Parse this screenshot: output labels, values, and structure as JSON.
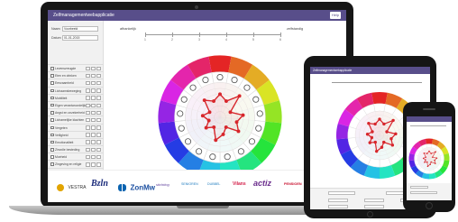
{
  "app": {
    "title": "Zelfmanagementwebapplicatie",
    "help_label": "Help"
  },
  "form": {
    "name_label": "Naam",
    "name_value": "Voorbeeld",
    "date_label": "Datum",
    "date_value": "01-01-2015"
  },
  "themes": [
    "Levensvreugde",
    "Eten en drinken",
    "Eenzaamheid",
    "Lichaamsbeweging",
    "Mobiliteit",
    "Eigen verantwoordelijkheid",
    "Angst en onzekerheid",
    "Lichamelijke klachten",
    "Vergeten",
    "Veiligheid",
    "Emotionaliteit",
    "Zinvolle besteding",
    "Moeheid",
    "Zingeving en religie",
    "Wonen en zorg"
  ],
  "scale": {
    "left_label": "afhankelijk",
    "right_label": "zelfstandig",
    "ticks": [
      "1",
      "2",
      "3",
      "4",
      "5",
      "6"
    ]
  },
  "chart_data": {
    "type": "radar",
    "values": [
      4,
      3,
      5,
      2,
      4,
      3,
      4,
      2,
      3,
      4,
      2,
      3,
      2,
      3,
      2,
      4,
      3
    ],
    "range": [
      0,
      6
    ],
    "line_color": "#d7262b"
  },
  "colors": {
    "accent": "#584e8a",
    "device": "#161616",
    "line": "#d7262b"
  },
  "wheel_icons": [
    "smile-icon",
    "fork-icon",
    "group-icon",
    "walking-icon",
    "car-icon",
    "scales-icon",
    "fear-icon",
    "bandage-icon",
    "memory-icon",
    "lock-icon",
    "heart-icon",
    "hands-icon",
    "bed-icon",
    "church-icon",
    "house-icon",
    "phone-icon",
    "book-icon"
  ],
  "logos": [
    "VESTRA",
    "Bzln",
    "ZonMw",
    "stichting",
    "SENIOREN",
    "DUBBEL",
    "Vilans",
    "actiz",
    "PENSIOEN"
  ]
}
